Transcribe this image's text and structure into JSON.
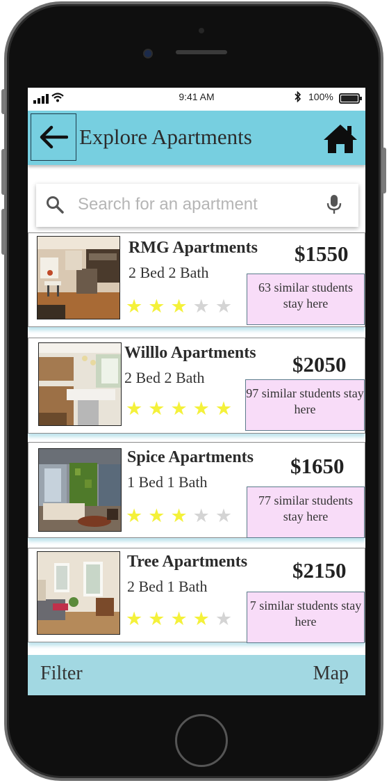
{
  "status_bar": {
    "time": "9:41 AM",
    "battery": "100%"
  },
  "header": {
    "title": "Explore Apartments",
    "back_icon": "arrow-left-icon",
    "home_icon": "home-icon"
  },
  "search": {
    "placeholder": "Search for an apartment",
    "icons": [
      "search-icon",
      "microphone-icon"
    ]
  },
  "listings": [
    {
      "name": "RMG Apartments",
      "rooms": "2 Bed 2 Bath",
      "price": "$1550",
      "rating": 3,
      "max_rating": 5,
      "students": "63 similar students stay here"
    },
    {
      "name": "Willlo Apartments",
      "rooms": "2 Bed 2 Bath",
      "price": "$2050",
      "rating": 5,
      "max_rating": 5,
      "students": "97 similar students stay here"
    },
    {
      "name": "Spice Apartments",
      "rooms": "1 Bed 1 Bath",
      "price": "$1650",
      "rating": 3,
      "max_rating": 5,
      "students": "77 similar students stay here"
    },
    {
      "name": "Tree Apartments",
      "rooms": "2 Bed 1 Bath",
      "price": "$2150",
      "rating": 4,
      "max_rating": 5,
      "students": "7 similar students stay here"
    }
  ],
  "bottom_bar": {
    "filter_label": "Filter",
    "map_label": "Map"
  },
  "colors": {
    "header": "#77cfe0",
    "bottom_bar": "#a2d8e2",
    "students_badge": "#f8dcf8",
    "star_filled": "#f4f13a",
    "star_empty": "#d4d4d4"
  }
}
